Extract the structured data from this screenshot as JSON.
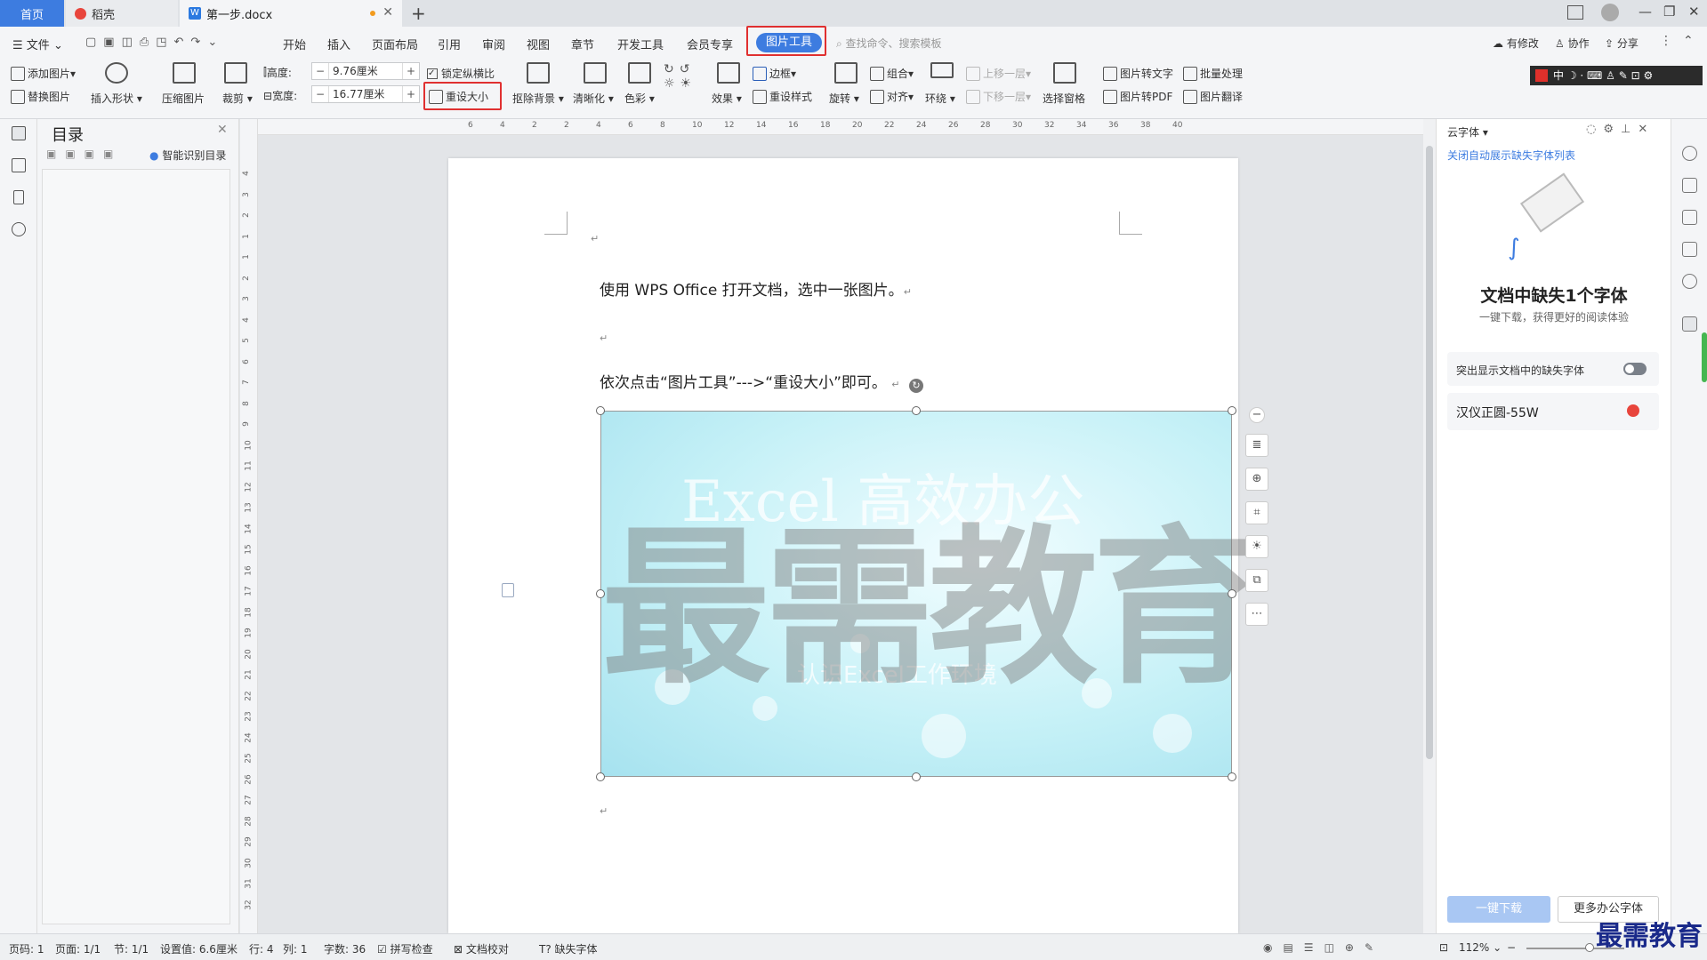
{
  "tabs": {
    "home": "首页",
    "daoke": "稻壳",
    "doc": "第一步.docx",
    "new": "+"
  },
  "menu": {
    "file": "文件",
    "items": [
      "开始",
      "插入",
      "页面布局",
      "引用",
      "审阅",
      "视图",
      "章节",
      "开发工具",
      "会员专享"
    ],
    "active": "图片工具",
    "search_placeholder": "查找命令、搜索模板",
    "right": [
      "有修改",
      "协作",
      "分享"
    ]
  },
  "ribbon": {
    "add_image": "添加图片",
    "replace_image": "替换图片",
    "insert_shape": "插入形状",
    "compress": "压缩图片",
    "crop": "裁剪",
    "height_label": "高度:",
    "height_value": "9.76厘米",
    "width_label": "宽度:",
    "width_value": "16.77厘米",
    "lock_ratio": "锁定纵横比",
    "reset_size": "重设大小",
    "remove_bg": "抠除背景",
    "sharpen": "清晰化",
    "color": "色彩",
    "effect": "效果",
    "border": "边框",
    "reset_style": "重设样式",
    "rotate": "旋转",
    "group": "组合",
    "align": "对齐",
    "wrap": "环绕",
    "bring_forward": "上移一层",
    "send_backward": "下移一层",
    "selection_pane": "选择窗格",
    "img_to_text": "图片转文字",
    "img_to_pdf": "图片转PDF",
    "batch": "批量处理",
    "img_translate": "图片翻译",
    "ime": "中"
  },
  "toc": {
    "title": "目录",
    "smart": "智能识别目录"
  },
  "ruler": {
    "h": [
      "6",
      "4",
      "2",
      "2",
      "4",
      "6",
      "8",
      "10",
      "12",
      "14",
      "16",
      "18",
      "20",
      "22",
      "24",
      "26",
      "28",
      "30",
      "32",
      "34",
      "36",
      "38",
      "40"
    ],
    "v": [
      "4",
      "3",
      "2",
      "1",
      "1",
      "2",
      "3",
      "4",
      "5",
      "6",
      "7",
      "8",
      "9",
      "10",
      "11",
      "12",
      "13",
      "14",
      "15",
      "16",
      "17",
      "18",
      "19",
      "20",
      "21",
      "22",
      "23",
      "24",
      "25",
      "26",
      "27",
      "28",
      "29",
      "30",
      "31",
      "32"
    ]
  },
  "doc": {
    "line1": "使用 WPS Office 打开文档，选中一张图片。",
    "line2": "依次点击“图片工具”--->“重设大小”即可。",
    "mark": "↵",
    "watermark": "最需教育",
    "img_text1": "Excel 高效办公",
    "img_text2": "认识Excel工作环境"
  },
  "cloud": {
    "title": "云字体",
    "link": "关闭自动展示缺失字体列表",
    "heading": "文档中缺失1个字体",
    "sub": "一键下载，获得更好的阅读体验",
    "toggle_label": "突出显示文档中的缺失字体",
    "font_name": "汉仪正圆-55W",
    "download": "一键下载",
    "more": "更多办公字体"
  },
  "status": {
    "page": "页码: 1",
    "pages": "页面: 1/1",
    "section": "节: 1/1",
    "setting": "设置值: 6.6厘米",
    "row": "行: 4",
    "col": "列: 1",
    "words": "字数: 36",
    "spell": "拼写检查",
    "proof": "文档校对",
    "missing_font": "缺失字体",
    "zoom": "112%"
  },
  "corner_watermark": "最需教育",
  "colors": {
    "accent": "#3d7ce0",
    "highlight": "#e03030",
    "orange": "#f29b1e"
  }
}
